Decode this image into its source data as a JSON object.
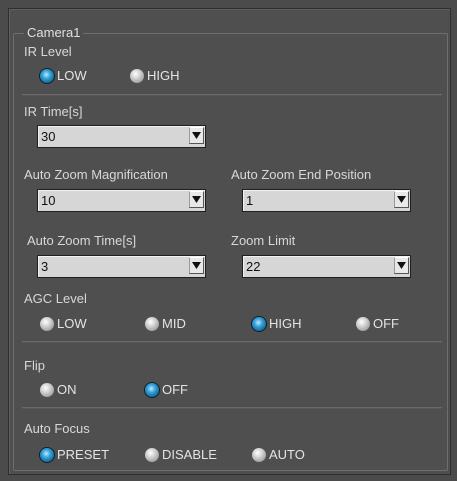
{
  "group_title": "Camera1",
  "ir_level": {
    "label": "IR Level",
    "options": [
      "LOW",
      "HIGH"
    ],
    "selected": "LOW"
  },
  "ir_time": {
    "label": "IR Time[s]",
    "value": "30"
  },
  "auto_zoom_magnification": {
    "label": "Auto Zoom Magnification",
    "value": "10"
  },
  "auto_zoom_end_position": {
    "label": "Auto Zoom End Position",
    "value": "1"
  },
  "auto_zoom_time": {
    "label": "Auto Zoom Time[s]",
    "value": "3"
  },
  "zoom_limit": {
    "label": "Zoom Limit",
    "value": "22"
  },
  "agc_level": {
    "label": "AGC Level",
    "options": [
      "LOW",
      "MID",
      "HIGH",
      "OFF"
    ],
    "selected": "HIGH"
  },
  "flip": {
    "label": "Flip",
    "options": [
      "ON",
      "OFF"
    ],
    "selected": "OFF"
  },
  "auto_focus": {
    "label": "Auto Focus",
    "options": [
      "PRESET",
      "DISABLE",
      "AUTO"
    ],
    "selected": "PRESET"
  },
  "colors": {
    "background": "#4f4f4f",
    "selected_radio": "#35a3dc",
    "unselected_radio": "#d4d4d4",
    "dropdown_field": "#d6d6d6"
  },
  "icons": {
    "dropdown_arrow": "triangle-down-icon",
    "radio": "radio-button-icon"
  }
}
